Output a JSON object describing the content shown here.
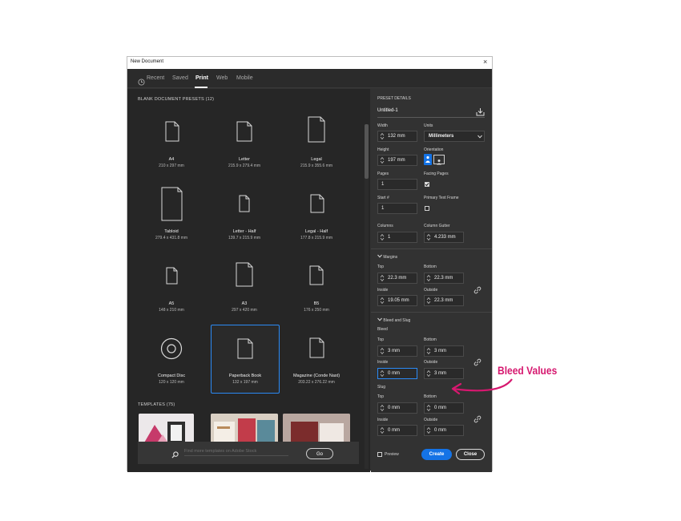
{
  "window": {
    "title": "New Document",
    "close_glyph": "×"
  },
  "tabs": [
    {
      "label": "Recent",
      "icon": "clock-icon"
    },
    {
      "label": "Saved"
    },
    {
      "label": "Print",
      "active": true
    },
    {
      "label": "Web"
    },
    {
      "label": "Mobile"
    }
  ],
  "presets": {
    "header": "BLANK DOCUMENT PRESETS",
    "count": "(12)",
    "items": [
      {
        "name": "A4",
        "size": "210 x 297 mm",
        "icon": "page-icon"
      },
      {
        "name": "Letter",
        "size": "215.9 x 279.4 mm",
        "icon": "page-icon"
      },
      {
        "name": "Legal",
        "size": "215.9 x 355.6 mm",
        "icon": "page-icon"
      },
      {
        "name": "Tabloid",
        "size": "279.4 x 431.8 mm",
        "icon": "page-icon"
      },
      {
        "name": "Letter - Half",
        "size": "139.7 x 215.9 mm",
        "icon": "page-icon"
      },
      {
        "name": "Legal - Half",
        "size": "177.8 x 215.9 mm",
        "icon": "page-icon"
      },
      {
        "name": "A5",
        "size": "148 x 210 mm",
        "icon": "page-icon"
      },
      {
        "name": "A3",
        "size": "297 x 420 mm",
        "icon": "page-icon"
      },
      {
        "name": "B5",
        "size": "176 x 250 mm",
        "icon": "page-icon"
      },
      {
        "name": "Compact Disc",
        "size": "120 x 120 mm",
        "icon": "disc-icon"
      },
      {
        "name": "Paperback Book",
        "size": "132 x 197 mm",
        "icon": "page-icon",
        "selected": true
      },
      {
        "name": "Magazine (Conde Nast)",
        "size": "203.22 x 276.22 mm",
        "icon": "page-icon"
      }
    ]
  },
  "templates": {
    "header": "TEMPLATES",
    "count": "(75)"
  },
  "search": {
    "placeholder": "Find more templates on Adobe Stock",
    "go_label": "Go"
  },
  "details": {
    "header": "PRESET DETAILS",
    "doc_name": "Untitled-1",
    "width_label": "Width",
    "width": "132 mm",
    "units_label": "Units",
    "units": "Millimeters",
    "height_label": "Height",
    "height": "197 mm",
    "orientation_label": "Orientation",
    "pages_label": "Pages",
    "pages": "1",
    "facing_label": "Facing Pages",
    "facing_checked": true,
    "start_label": "Start #",
    "start": "1",
    "ptf_label": "Primary Text Frame",
    "ptf_checked": false,
    "columns_label": "Columns",
    "columns": "1",
    "gutter_label": "Column Gutter",
    "gutter": "4.233 mm",
    "margins_header": "Margins",
    "margins": {
      "top_label": "Top",
      "top": "22.3 mm",
      "bottom_label": "Bottom",
      "bottom": "22.3 mm",
      "inside_label": "Inside",
      "inside": "19.05 mm",
      "outside_label": "Outside",
      "outside": "22.3 mm"
    },
    "bleed_slug_header": "Bleed and Slug",
    "bleed_label": "Bleed",
    "bleed": {
      "top_label": "Top",
      "top": "3 mm",
      "bottom_label": "Bottom",
      "bottom": "3 mm",
      "inside_label": "Inside",
      "inside": "0 mm",
      "outside_label": "Outside",
      "outside": "3 mm"
    },
    "slug_label": "Slug",
    "slug": {
      "top_label": "Top",
      "top": "0 mm",
      "bottom_label": "Bottom",
      "bottom": "0 mm",
      "inside_label": "Inside",
      "inside": "0 mm",
      "outside_label": "Outside",
      "outside": "0 mm"
    },
    "preview_label": "Preview",
    "preview_checked": false,
    "create_label": "Create",
    "close_label": "Close"
  },
  "annotation": {
    "text": "Bleed Values",
    "color": "#d6186f"
  },
  "colors": {
    "accent": "#1473e6",
    "selection": "#2b8af5",
    "panel": "#262626"
  }
}
